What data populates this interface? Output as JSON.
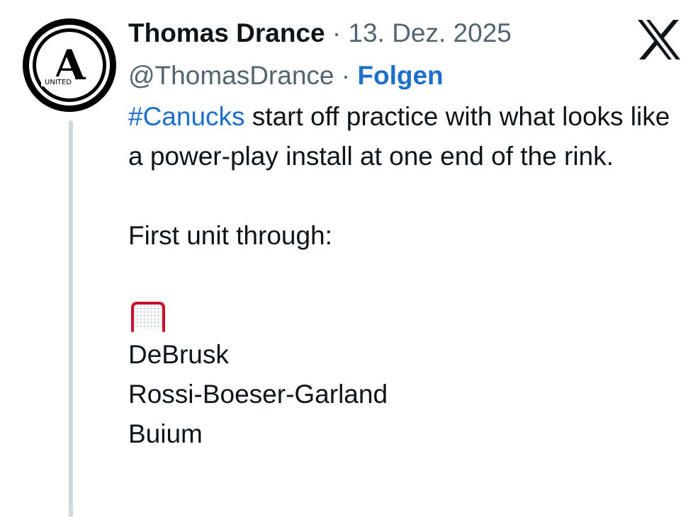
{
  "author": {
    "display_name": "Thomas Drance",
    "handle": "@ThomasDrance",
    "avatar": {
      "letter": "A",
      "sub_text": "UNITED"
    }
  },
  "header": {
    "separator": "·",
    "date": "13. Dez. 2025",
    "follow_label": "Folgen",
    "platform_icon": "x-logo-icon"
  },
  "tweet": {
    "hashtag": "#Canucks",
    "line1_rest": " start off practice with what looks like a power-play install at one end of the rink.",
    "line2": "First unit through:",
    "goal_icon": "goal-net-emoji-icon",
    "lines": [
      "DeBrusk",
      "Rossi-Boeser-Garland",
      "Buium"
    ]
  },
  "colors": {
    "link": "#1d6fc9",
    "text": "#0f1419",
    "muted": "#536471",
    "thread_line": "#cfd9de",
    "net_red": "#c8102e"
  }
}
